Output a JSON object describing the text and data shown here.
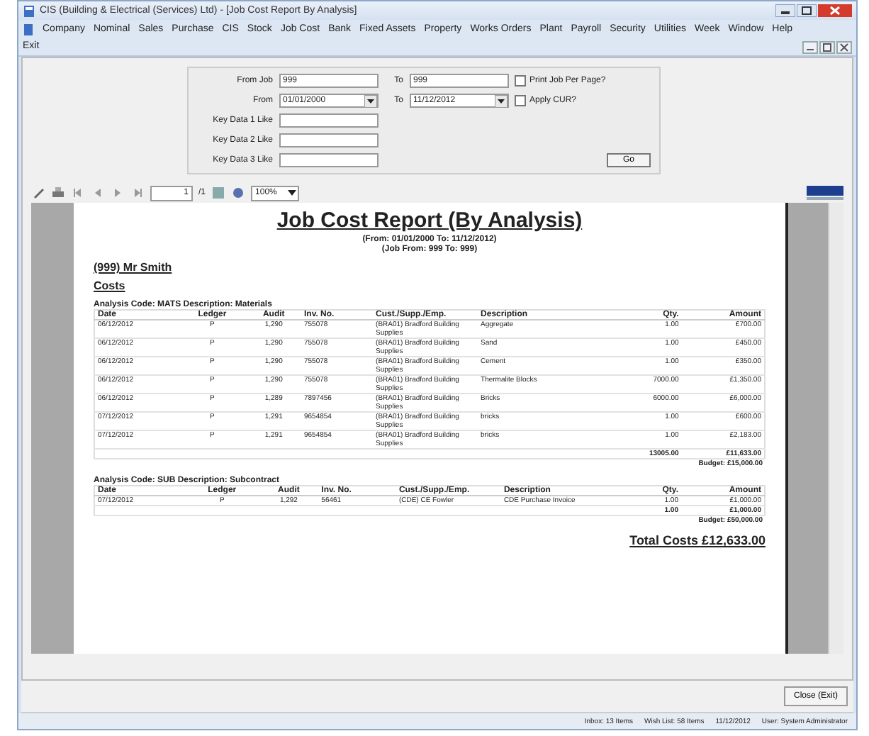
{
  "window": {
    "title": "CIS (Building & Electrical (Services) Ltd) - [Job Cost Report By Analysis]"
  },
  "menu": [
    "Company",
    "Nominal",
    "Sales",
    "Purchase",
    "CIS",
    "Stock",
    "Job Cost",
    "Bank",
    "Fixed Assets",
    "Property",
    "Works Orders",
    "Plant",
    "Payroll",
    "Security",
    "Utilities",
    "Week",
    "Window",
    "Help",
    "Exit"
  ],
  "filters": {
    "from_job_label": "From Job",
    "from_job": "999",
    "to_job_label": "To",
    "to_job": "999",
    "from_date_label": "From",
    "from_date": "01/01/2000",
    "to_date_label": "To",
    "to_date": "11/12/2012",
    "options": [
      {
        "label": "Print Job Per Page?",
        "checked": false
      },
      {
        "label": "Apply CUR?",
        "checked": false
      }
    ],
    "key_data": [
      "Key Data 1 Like",
      "Key Data 2 Like",
      "Key Data 3 Like"
    ],
    "go": "Go"
  },
  "toolbar": {
    "page": "1",
    "page_count": "/1",
    "zoom": "100%"
  },
  "report": {
    "title": "Job Cost Report (By Analysis)",
    "subtitle": [
      "(From: 01/01/2000 To: 11/12/2012)",
      "(Job From: 999 To: 999)"
    ],
    "job": "(999) Mr Smith",
    "section": "Costs",
    "analyses": [
      {
        "heading": "Analysis Code: MATS Description: Materials",
        "columns": [
          "Date",
          "Ledger",
          "Audit",
          "Inv. No.",
          "Cust./Supp./Emp.",
          "Description",
          "Qty.",
          "Amount"
        ],
        "rows": [
          [
            "06/12/2012",
            "P",
            "1,290",
            "755078",
            "(BRA01) Bradford Building Supplies",
            "Aggregate",
            "1.00",
            "£700.00"
          ],
          [
            "06/12/2012",
            "P",
            "1,290",
            "755078",
            "(BRA01) Bradford Building Supplies",
            "Sand",
            "1.00",
            "£450.00"
          ],
          [
            "06/12/2012",
            "P",
            "1,290",
            "755078",
            "(BRA01) Bradford Building Supplies",
            "Cement",
            "1.00",
            "£350.00"
          ],
          [
            "06/12/2012",
            "P",
            "1,290",
            "755078",
            "(BRA01) Bradford Building Supplies",
            "Thermalite Blocks",
            "7000.00",
            "£1,350.00"
          ],
          [
            "06/12/2012",
            "P",
            "1,289",
            "7897456",
            "(BRA01) Bradford Building Supplies",
            "Bricks",
            "6000.00",
            "£6,000.00"
          ],
          [
            "07/12/2012",
            "P",
            "1,291",
            "9654854",
            "(BRA01) Bradford Building Supplies",
            "bricks",
            "1.00",
            "£600.00"
          ],
          [
            "07/12/2012",
            "P",
            "1,291",
            "9654854",
            "(BRA01) Bradford Building Supplies",
            "bricks",
            "1.00",
            "£2,183.00"
          ]
        ],
        "total_qty": "13005.00",
        "total_amount": "£11,633.00",
        "budget": "Budget: £15,000.00"
      },
      {
        "heading": "Analysis Code: SUB Description: Subcontract",
        "columns": [
          "Date",
          "Ledger",
          "Audit",
          "Inv. No.",
          "Cust./Supp./Emp.",
          "Description",
          "Qty.",
          "Amount"
        ],
        "rows": [
          [
            "07/12/2012",
            "P",
            "1,292",
            "56461",
            "(CDE) CE Fowler",
            "CDE Purchase Invoice",
            "1.00",
            "£1,000.00"
          ]
        ],
        "total_qty": "1.00",
        "total_amount": "£1,000.00",
        "budget": "Budget: £50,000.00"
      }
    ],
    "total": "Total Costs £12,633.00"
  },
  "close_button": "Close (Exit)",
  "status_bar": [
    "Inbox: 13 Items",
    "Wish List: 58 Items",
    "11/12/2012",
    "User: System Administrator"
  ]
}
